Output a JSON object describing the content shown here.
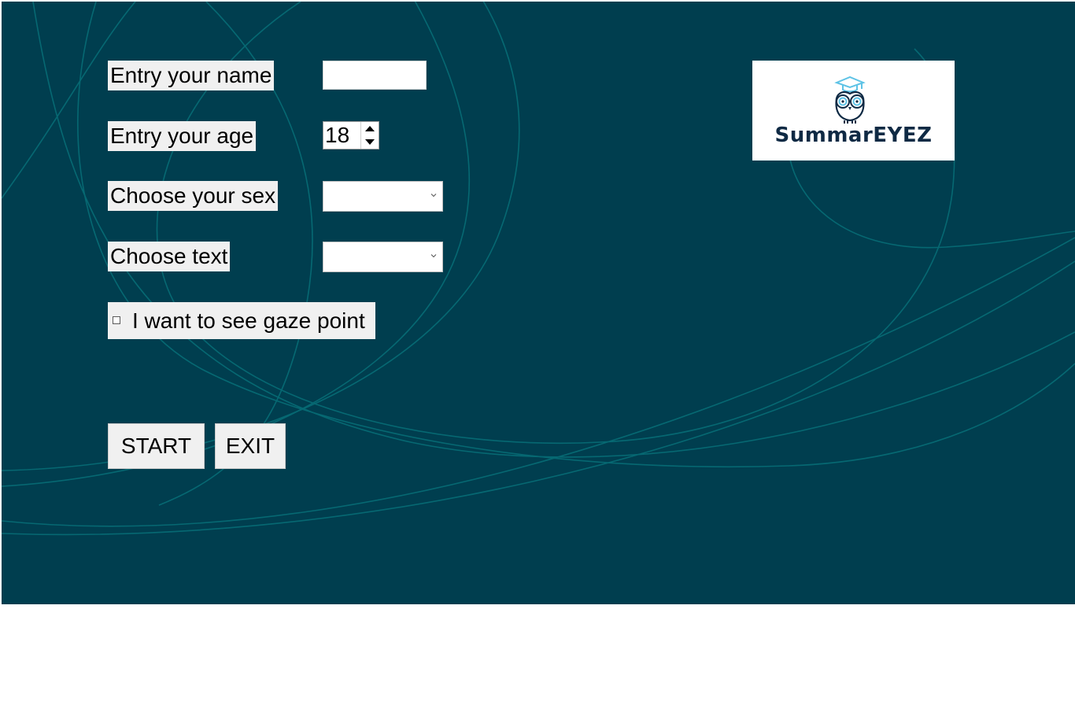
{
  "form": {
    "name_label": "Entry your name",
    "name_value": "",
    "age_label": "Entry your age",
    "age_value": "18",
    "sex_label": "Choose your sex",
    "sex_value": "",
    "text_label": "Choose text",
    "text_value": "",
    "gaze_label": "I want to see gaze point",
    "gaze_checked": false
  },
  "buttons": {
    "start_label": "START",
    "exit_label": "EXIT"
  },
  "logo": {
    "wordmark": "SummarEYEZ",
    "icon": "owl-with-graduation-cap-icon"
  },
  "colors": {
    "background": "#003e4f",
    "curves": "#0c8c8f",
    "logo_text": "#0f2a44",
    "logo_accent": "#5ec3e6"
  }
}
